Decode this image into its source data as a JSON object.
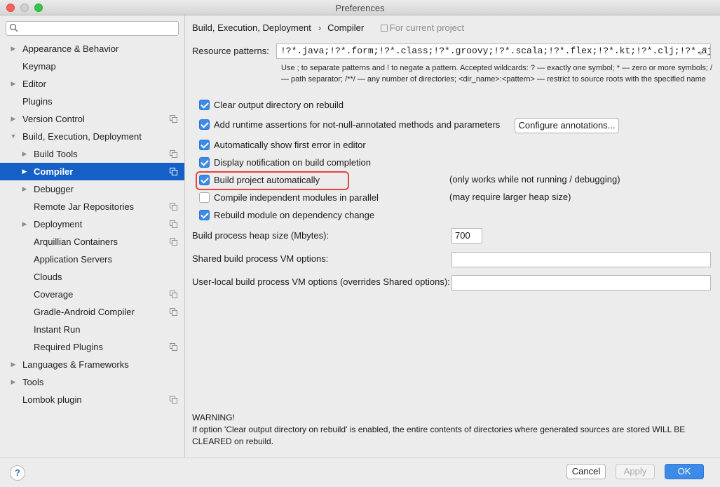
{
  "window": {
    "title": "Preferences"
  },
  "search": {
    "placeholder": ""
  },
  "sidebar": {
    "items": [
      {
        "label": "Appearance & Behavior",
        "indent": 0,
        "arrow": "right",
        "project": false
      },
      {
        "label": "Keymap",
        "indent": 0,
        "arrow": "none",
        "project": false
      },
      {
        "label": "Editor",
        "indent": 0,
        "arrow": "right",
        "project": false
      },
      {
        "label": "Plugins",
        "indent": 0,
        "arrow": "none",
        "project": false
      },
      {
        "label": "Version Control",
        "indent": 0,
        "arrow": "right",
        "project": true
      },
      {
        "label": "Build, Execution, Deployment",
        "indent": 0,
        "arrow": "down",
        "project": false
      },
      {
        "label": "Build Tools",
        "indent": 1,
        "arrow": "right",
        "project": true
      },
      {
        "label": "Compiler",
        "indent": 1,
        "arrow": "right",
        "project": true,
        "selected": true
      },
      {
        "label": "Debugger",
        "indent": 1,
        "arrow": "right",
        "project": false
      },
      {
        "label": "Remote Jar Repositories",
        "indent": 1,
        "arrow": "none",
        "project": true
      },
      {
        "label": "Deployment",
        "indent": 1,
        "arrow": "right",
        "project": true
      },
      {
        "label": "Arquillian Containers",
        "indent": 1,
        "arrow": "none",
        "project": true
      },
      {
        "label": "Application Servers",
        "indent": 1,
        "arrow": "none",
        "project": false
      },
      {
        "label": "Clouds",
        "indent": 1,
        "arrow": "none",
        "project": false
      },
      {
        "label": "Coverage",
        "indent": 1,
        "arrow": "none",
        "project": true
      },
      {
        "label": "Gradle-Android Compiler",
        "indent": 1,
        "arrow": "none",
        "project": true
      },
      {
        "label": "Instant Run",
        "indent": 1,
        "arrow": "none",
        "project": false
      },
      {
        "label": "Required Plugins",
        "indent": 1,
        "arrow": "none",
        "project": true
      },
      {
        "label": "Languages & Frameworks",
        "indent": 0,
        "arrow": "right",
        "project": false
      },
      {
        "label": "Tools",
        "indent": 0,
        "arrow": "right",
        "project": false
      },
      {
        "label": "Lombok plugin",
        "indent": 0,
        "arrow": "none",
        "project": true
      }
    ]
  },
  "breadcrumb": {
    "parent": "Build, Execution, Deployment",
    "separator": "›",
    "current": "Compiler",
    "scope": "For current project"
  },
  "resource_patterns": {
    "label": "Resource patterns:",
    "value": "!?*.java;!?*.form;!?*.class;!?*.groovy;!?*.scala;!?*.flex;!?*.kt;!?*.clj;!?*.aj",
    "hint": "Use ; to separate patterns and ! to negate a pattern. Accepted wildcards: ? — exactly one symbol; * — zero or more symbols; / — path separator; /**/ — any number of directories; <dir_name>:<pattern> — restrict to source roots with the specified name"
  },
  "options": [
    {
      "label": "Clear output directory on rebuild",
      "checked": true
    },
    {
      "label": "Add runtime assertions for not-null-annotated methods and parameters",
      "checked": true
    },
    {
      "label": "Automatically show first error in editor",
      "checked": true
    },
    {
      "label": "Display notification on build completion",
      "checked": true
    },
    {
      "label": "Build project automatically",
      "checked": true
    },
    {
      "label": "Compile independent modules in parallel",
      "checked": false
    },
    {
      "label": "Rebuild module on dependency change",
      "checked": true
    }
  ],
  "configure_annotations_label": "Configure annotations...",
  "notes": {
    "build_auto": "(only works while not running / debugging)",
    "parallel": "(may require larger heap size)"
  },
  "fields": {
    "heap_label": "Build process heap size (Mbytes):",
    "heap_value": "700",
    "shared_vm_label": "Shared build process VM options:",
    "shared_vm_value": "",
    "user_vm_label": "User-local build process VM options (overrides Shared options):",
    "user_vm_value": ""
  },
  "warning": {
    "title": "WARNING!",
    "text": "If option 'Clear output directory on rebuild' is enabled, the entire contents of directories where generated sources are stored WILL BE CLEARED on rebuild."
  },
  "buttons": {
    "help": "?",
    "cancel": "Cancel",
    "apply": "Apply",
    "ok": "OK"
  },
  "colors": {
    "selection": "#1560c7",
    "accent": "#3c8be9",
    "highlight_border": "#e8463a"
  }
}
